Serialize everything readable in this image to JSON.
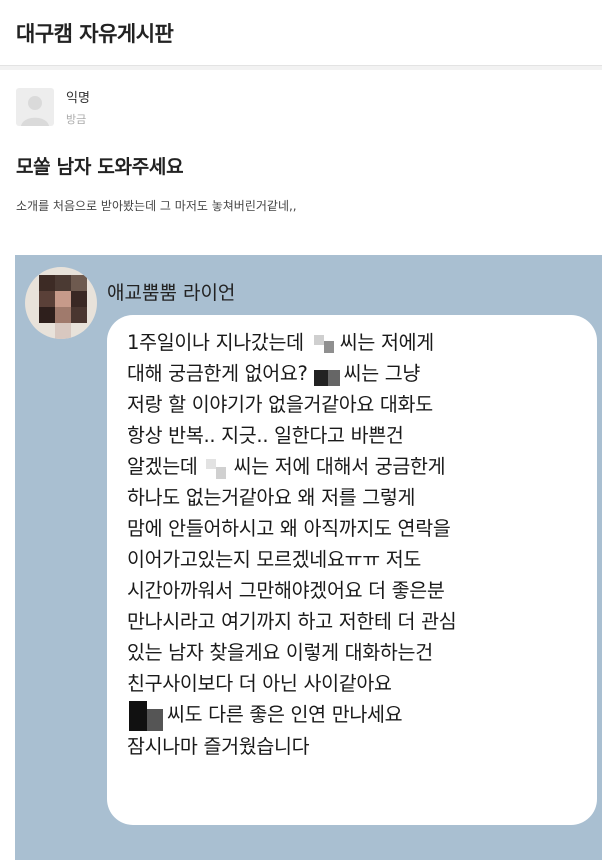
{
  "header": {
    "board_title": "대구캠 자유게시판"
  },
  "post": {
    "author": "익명",
    "time": "방금",
    "title": "모쏠 남자 도와주세요",
    "body": "소개를 처음으로 받아봤는데 그 마저도 놓쳐버린거같네,,"
  },
  "chat": {
    "sender_name": "애교뿜뿜 라이언",
    "lines": [
      "1주일이나 지나갔는데",
      "씨는 저에게",
      "대해 궁금한게 없어요?",
      "씨는 그냥",
      "저랑 할 이야기가 없을거같아요 대화도",
      "항상 반복.. 지긋.. 일한다고 바쁜건",
      "알겠는데",
      "씨는 저에 대해서 궁금한게",
      "하나도 없는거같아요 왜 저를 그렇게",
      "맘에 안들어하시고 왜 아직까지도 연락을",
      "이어가고있는지 모르겠네요ㅠㅠ 저도",
      "시간아까워서 그만해야겠어요 더 좋은분",
      "만나시라고 여기까지 하고 저한테 더 관심",
      "있는 남자 찾을게요 이렇게 대화하는건",
      "친구사이보다 더 아닌 사이같아요",
      "씨도 다른 좋은 인연 만나세요",
      "잠시나마 즐거웠습니다"
    ]
  },
  "icons": {
    "avatar": "default-user-avatar"
  }
}
